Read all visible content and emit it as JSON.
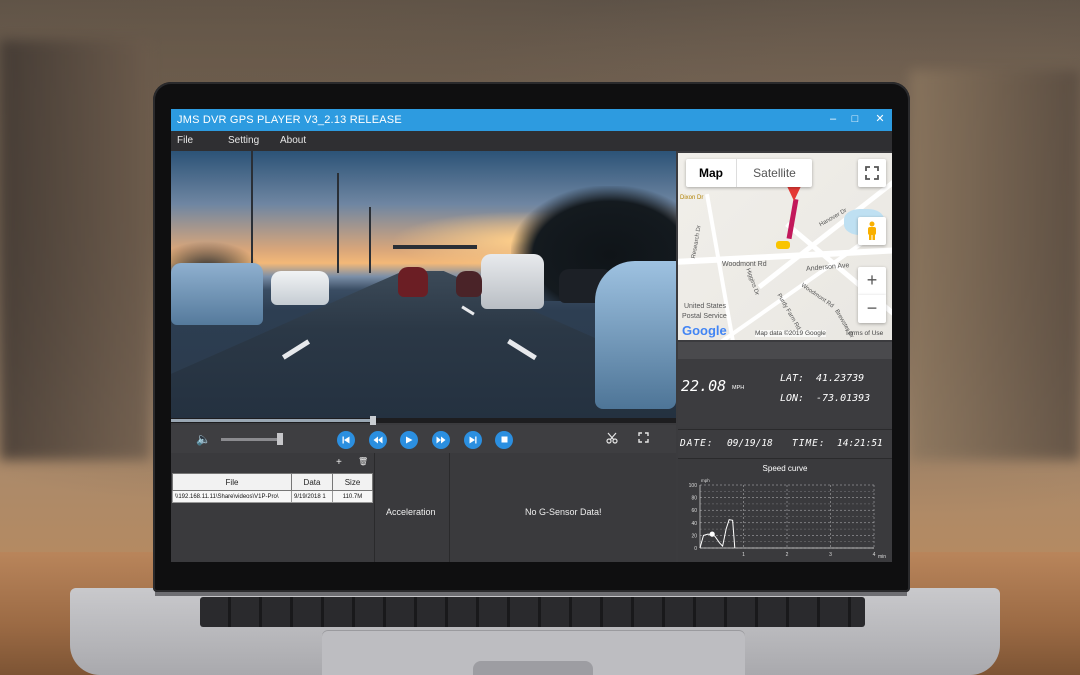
{
  "window": {
    "title": "JMS DVR GPS PLAYER V3_2.13 RELEASE",
    "minimize_glyph": "–",
    "maximize_glyph": "□",
    "close_glyph": "✕"
  },
  "menu": {
    "items": [
      "File",
      "Setting",
      "About"
    ]
  },
  "controls": {
    "icons": [
      "volume-icon",
      "skip-back-icon",
      "rewind-icon",
      "play-icon",
      "fast-forward-icon",
      "skip-forward-icon",
      "stop-icon",
      "cut-icon",
      "fullscreen-icon"
    ],
    "volume_level": 0.95,
    "progress": 0.4
  },
  "file_panel": {
    "add_glyph": "+",
    "delete_glyph": "🗑",
    "columns": [
      "File",
      "Data",
      "Size"
    ],
    "rows": [
      {
        "file": "\\\\192.168.11.11\\Share\\videos\\V1P-Pro\\",
        "date": "9/19/2018 1",
        "size": "110.7M"
      }
    ],
    "acceleration_label": "Acceleration",
    "gsensor_message": "No G-Sensor Data!"
  },
  "map": {
    "tabs": [
      "Map",
      "Satellite"
    ],
    "active_tab": "Map",
    "labels": [
      "Woodmont Rd",
      "Anderson Ave",
      "United States",
      "Postal Service",
      "Research Dr",
      "Hanover Dr",
      "Higgins Dr",
      "Woodmont Rd",
      "Purdy Farm Rd",
      "Brewster Dr",
      "Dixon Dr"
    ],
    "attribution": "Map data ©2019 Google",
    "terms": "Terms of Use",
    "google_logo": "Google",
    "zoom_in": "+",
    "zoom_out": "−"
  },
  "stats": {
    "speed": "22.08",
    "speed_unit": "MPH",
    "lat_label": "LAT:",
    "lat_value": "41.23739",
    "lon_label": "LON:",
    "lon_value": "-73.01393",
    "date_label": "DATE:",
    "date_value": "09/19/18",
    "time_label": "TIME:",
    "time_value": "14:21:51"
  },
  "chart_data": {
    "type": "line",
    "title": "Speed curve",
    "ylabel": "mph",
    "xlabel": "min",
    "ylim": [
      0,
      100
    ],
    "xlim": [
      0,
      4
    ],
    "yticks": [
      0,
      20,
      40,
      60,
      80,
      100
    ],
    "yticks_minor": [
      10,
      30,
      50,
      70,
      90
    ],
    "xticks": [
      1,
      2,
      3,
      4
    ],
    "grid": true,
    "series": [
      {
        "x": [
          0,
          0.08,
          0.18,
          0.3,
          0.35,
          0.45,
          0.52,
          0.6,
          0.67,
          0.75,
          0.8
        ],
        "values": [
          0,
          20,
          22,
          21,
          18,
          8,
          3,
          30,
          45,
          44,
          0
        ]
      }
    ],
    "marker": {
      "x": 0.28,
      "y": 22
    }
  }
}
